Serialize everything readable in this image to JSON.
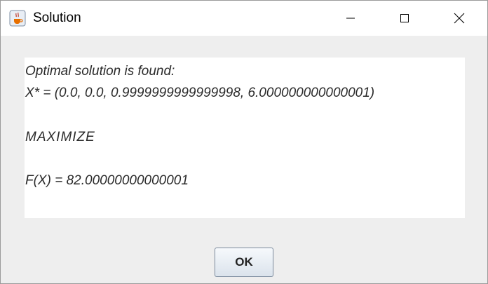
{
  "window": {
    "title": "Solution",
    "icon": "java-cup-icon"
  },
  "message": {
    "line1": "Optimal solution is found:",
    "line2": "X* = (0.0, 0.0, 0.9999999999999998, 6.000000000000001)",
    "line3": "MAXIMIZE",
    "line4": "F(X) = 82.00000000000001"
  },
  "buttons": {
    "ok_label": "OK"
  },
  "caption_buttons": [
    "minimize-icon",
    "maximize-icon",
    "close-icon"
  ]
}
